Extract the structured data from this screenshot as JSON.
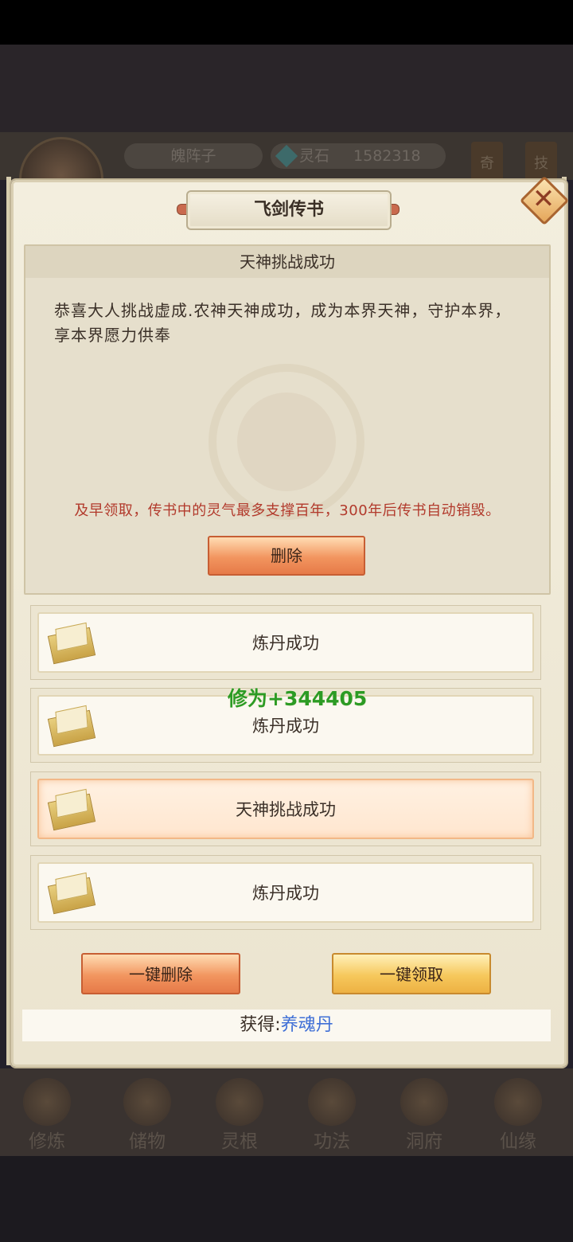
{
  "header": {
    "player_name": "魄阵子",
    "stone_label": "灵石",
    "stone_count": "1582318",
    "side_tag_1": "奇",
    "side_tag_2": "技"
  },
  "modal": {
    "title": "飞剑传书",
    "close_icon": "close-x",
    "message": {
      "title": "天神挑战成功",
      "body": "恭喜大人挑战虚成.农神天神成功，成为本界天神，守护本界，享本界愿力供奉",
      "warning": "及早领取，传书中的灵气最多支撑百年，300年后传书自动销毁。",
      "delete_label": "删除"
    },
    "mails": [
      {
        "label": "炼丹成功",
        "icon": "envelope-icon",
        "selected": false
      },
      {
        "label": "炼丹成功",
        "icon": "envelope-icon",
        "selected": false
      },
      {
        "label": "天神挑战成功",
        "icon": "envelope-icon",
        "selected": true
      },
      {
        "label": "炼丹成功",
        "icon": "envelope-icon",
        "selected": false
      }
    ],
    "floating_gain": "修为+344405",
    "delete_all_label": "一键删除",
    "claim_all_label": "一键领取",
    "reward_label": "获得:",
    "reward_item": "养魂丹"
  },
  "bottom_nav": [
    {
      "label": "修炼"
    },
    {
      "label": "储物"
    },
    {
      "label": "灵根"
    },
    {
      "label": "功法"
    },
    {
      "label": "洞府"
    },
    {
      "label": "仙缘"
    }
  ],
  "colors": {
    "warning_text": "#b23a2c",
    "gain_text": "#2c9b24",
    "reward_item": "#3f6fd6",
    "panel_bg": "#f3eede"
  }
}
